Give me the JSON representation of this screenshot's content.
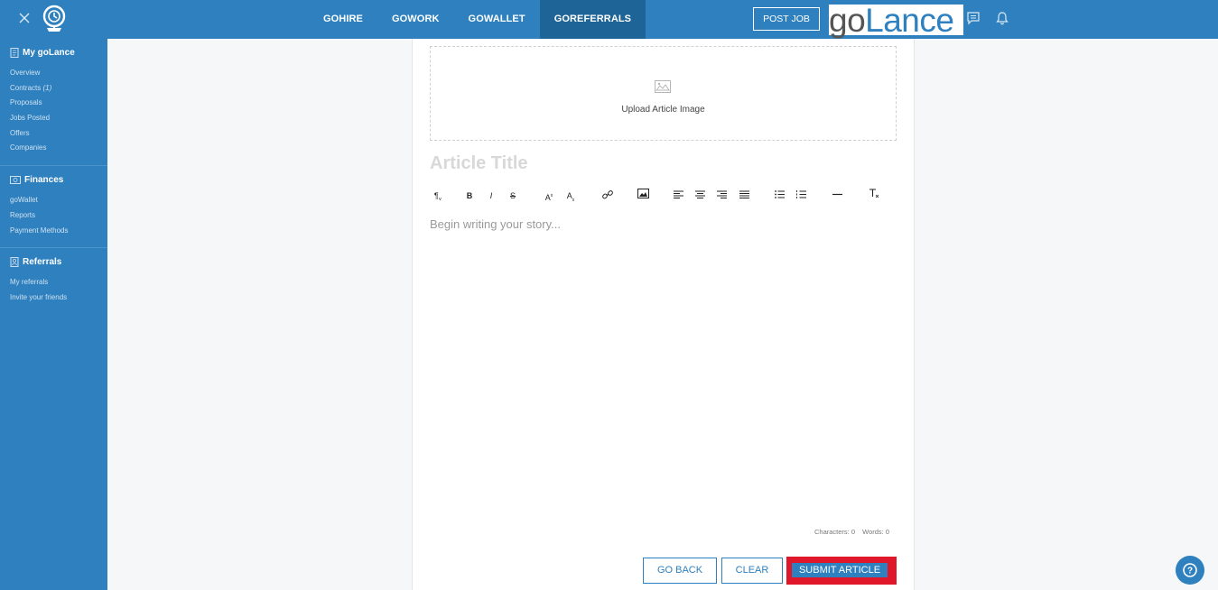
{
  "header": {
    "close_icon": "close-icon",
    "brand_icon": "golance-globe-icon",
    "nav": [
      {
        "label": "GOHIRE",
        "active": false
      },
      {
        "label": "GOWORK",
        "active": false
      },
      {
        "label": "GOWALLET",
        "active": false
      },
      {
        "label": "GOREFERRALS",
        "active": true
      }
    ],
    "post_job_label": "POST JOB",
    "logo": {
      "go": "go",
      "lance": "Lance"
    },
    "messages_icon": "chat-icon",
    "notifications_icon": "bell-icon"
  },
  "sidebar": {
    "sections": [
      {
        "title": "My goLance",
        "icon": "document-icon",
        "items": [
          {
            "label": "Overview"
          },
          {
            "label": "Contracts",
            "count": "(1)"
          },
          {
            "label": "Proposals"
          },
          {
            "label": "Jobs Posted"
          },
          {
            "label": "Offers"
          },
          {
            "label": "Companies"
          }
        ]
      },
      {
        "title": "Finances",
        "icon": "money-icon",
        "items": [
          {
            "label": "goWallet"
          },
          {
            "label": "Reports"
          },
          {
            "label": "Payment Methods"
          }
        ]
      },
      {
        "title": "Referrals",
        "icon": "referral-icon",
        "items": [
          {
            "label": "My referrals"
          },
          {
            "label": "Invite your friends"
          }
        ]
      }
    ]
  },
  "editor": {
    "upload_label": "Upload Article Image",
    "title_placeholder": "Article Title",
    "body_placeholder": "Begin writing your story...",
    "characters_label": "Characters: 0",
    "words_label": "Words: 0",
    "toolbar": {
      "paragraph": "¶",
      "bold": "B",
      "italic": "I",
      "strike": "S",
      "superscript": "A",
      "subscript": "A"
    }
  },
  "actions": {
    "go_back_label": "GO BACK",
    "clear_label": "CLEAR",
    "submit_label": "SUBMIT ARTICLE"
  },
  "colors": {
    "primary": "#2e80bf",
    "primary_dark": "#1f6497",
    "highlight": "#e0162a"
  }
}
